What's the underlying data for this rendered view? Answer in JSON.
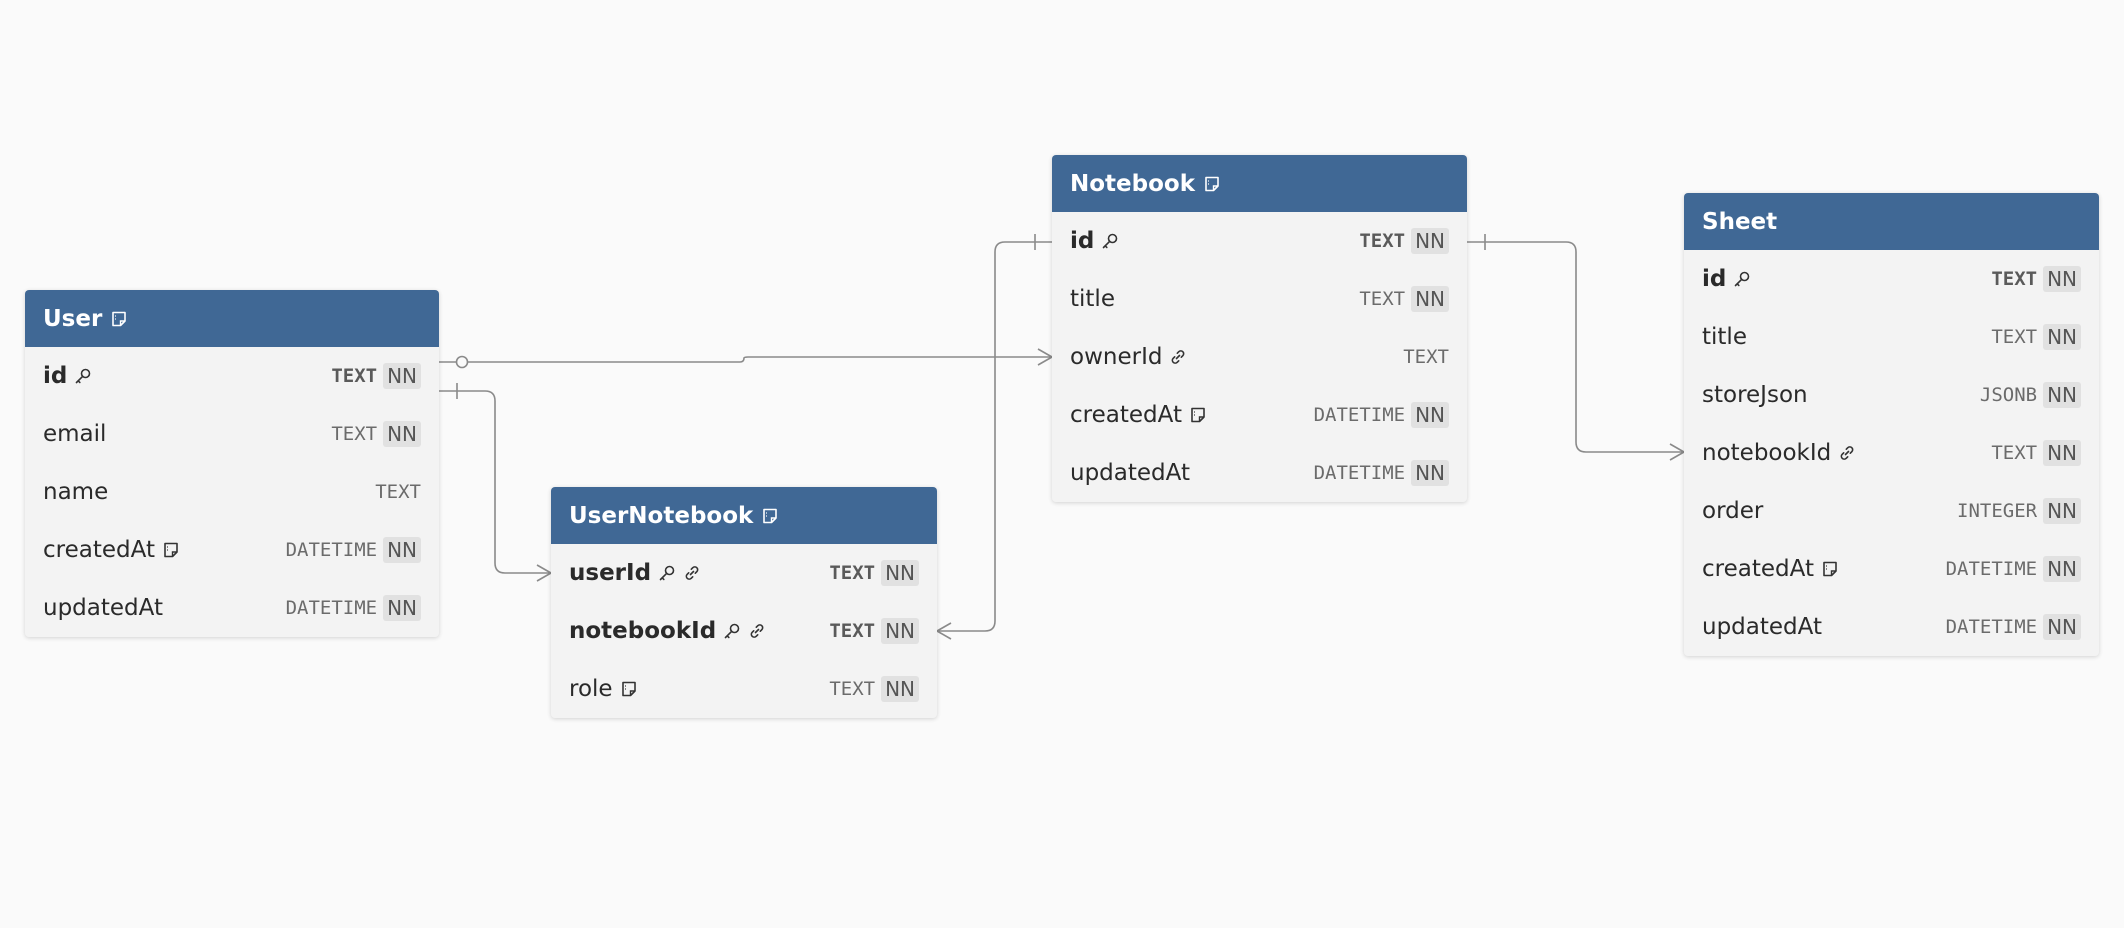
{
  "colors": {
    "header": "#406895",
    "body": "#f3f3f3",
    "background": "#fafafa",
    "edge": "#8a8a8a",
    "nn_badge": "#e1e1e1"
  },
  "entities": [
    {
      "id": "User",
      "name": "User",
      "note_icon": "note-icon",
      "columns": [
        {
          "name": "id",
          "type": "TEXT",
          "nn": "NN",
          "pk": true,
          "icons": [
            "key-icon"
          ]
        },
        {
          "name": "email",
          "type": "TEXT",
          "nn": "NN",
          "icons": []
        },
        {
          "name": "name",
          "type": "TEXT",
          "nn": "",
          "icons": []
        },
        {
          "name": "createdAt",
          "type": "DATETIME",
          "nn": "NN",
          "icons": [
            "note-icon"
          ]
        },
        {
          "name": "updatedAt",
          "type": "DATETIME",
          "nn": "NN",
          "icons": []
        }
      ]
    },
    {
      "id": "UserNotebook",
      "name": "UserNotebook",
      "note_icon": "note-icon",
      "columns": [
        {
          "name": "userId",
          "type": "TEXT",
          "nn": "NN",
          "pk": true,
          "icons": [
            "key-icon",
            "link-icon"
          ]
        },
        {
          "name": "notebookId",
          "type": "TEXT",
          "nn": "NN",
          "pk": true,
          "icons": [
            "key-icon",
            "link-icon"
          ]
        },
        {
          "name": "role",
          "type": "TEXT",
          "nn": "NN",
          "icons": [
            "note-icon"
          ]
        }
      ]
    },
    {
      "id": "Notebook",
      "name": "Notebook",
      "note_icon": "note-icon",
      "columns": [
        {
          "name": "id",
          "type": "TEXT",
          "nn": "NN",
          "pk": true,
          "icons": [
            "key-icon"
          ]
        },
        {
          "name": "title",
          "type": "TEXT",
          "nn": "NN",
          "icons": []
        },
        {
          "name": "ownerId",
          "type": "TEXT",
          "nn": "",
          "icons": [
            "link-icon"
          ]
        },
        {
          "name": "createdAt",
          "type": "DATETIME",
          "nn": "NN",
          "icons": [
            "note-icon"
          ]
        },
        {
          "name": "updatedAt",
          "type": "DATETIME",
          "nn": "NN",
          "icons": []
        }
      ]
    },
    {
      "id": "Sheet",
      "name": "Sheet",
      "note_icon": "",
      "columns": [
        {
          "name": "id",
          "type": "TEXT",
          "nn": "NN",
          "pk": true,
          "icons": [
            "key-icon"
          ]
        },
        {
          "name": "title",
          "type": "TEXT",
          "nn": "NN",
          "icons": []
        },
        {
          "name": "storeJson",
          "type": "JSONB",
          "nn": "NN",
          "icons": []
        },
        {
          "name": "notebookId",
          "type": "TEXT",
          "nn": "NN",
          "icons": [
            "link-icon"
          ]
        },
        {
          "name": "order",
          "type": "INTEGER",
          "nn": "NN",
          "icons": []
        },
        {
          "name": "createdAt",
          "type": "DATETIME",
          "nn": "NN",
          "icons": [
            "note-icon"
          ]
        },
        {
          "name": "updatedAt",
          "type": "DATETIME",
          "nn": "NN",
          "icons": []
        }
      ]
    }
  ],
  "relationships": [
    {
      "from": "User.id",
      "from_marker": "zero-or-one",
      "to": "Notebook.ownerId",
      "to_marker": "many"
    },
    {
      "from": "User.id",
      "from_marker": "one",
      "to": "UserNotebook.userId",
      "to_marker": "many"
    },
    {
      "from": "Notebook.id",
      "from_marker": "one",
      "to": "UserNotebook.notebookId",
      "to_marker": "many"
    },
    {
      "from": "Notebook.id",
      "from_marker": "one",
      "to": "Sheet.notebookId",
      "to_marker": "many"
    }
  ]
}
